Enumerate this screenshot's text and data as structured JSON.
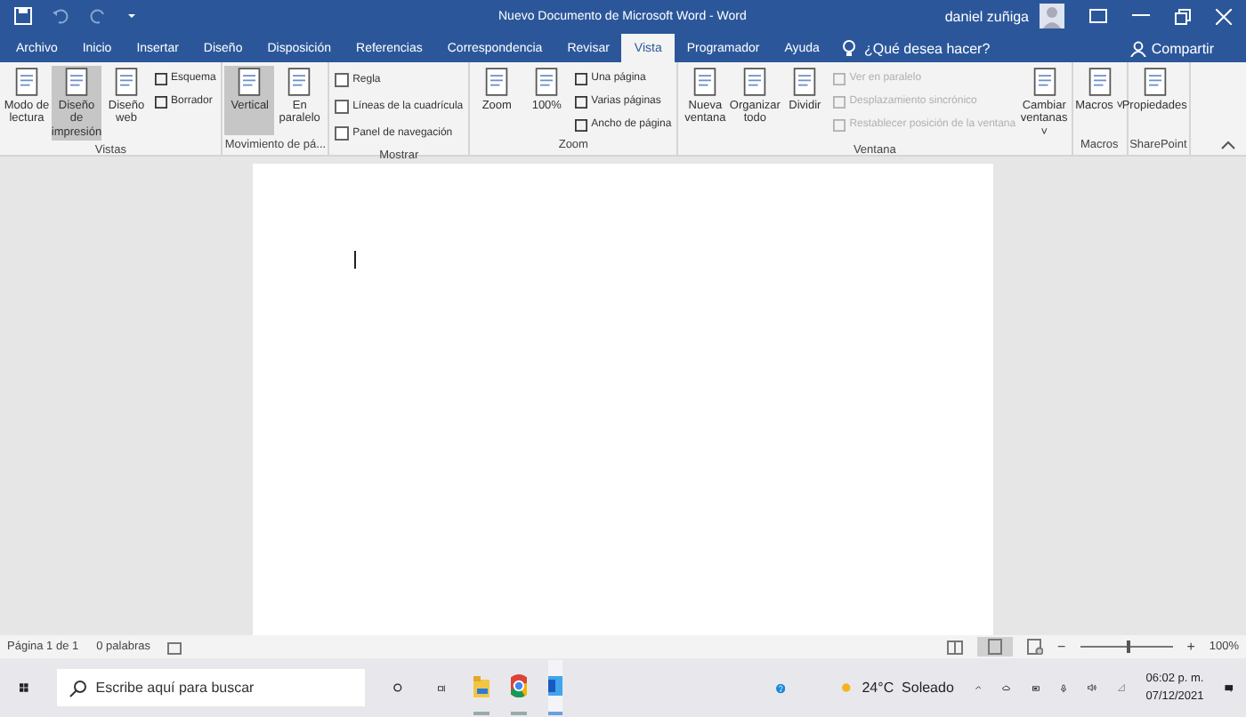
{
  "title": "Nuevo Documento de Microsoft Word  -  Word",
  "user": "daniel zuñiga",
  "tabs": [
    {
      "label": "Archivo",
      "selected": false
    },
    {
      "label": "Inicio",
      "selected": false
    },
    {
      "label": "Insertar",
      "selected": false
    },
    {
      "label": "Diseño",
      "selected": false
    },
    {
      "label": "Disposición",
      "selected": false
    },
    {
      "label": "Referencias",
      "selected": false
    },
    {
      "label": "Correspondencia",
      "selected": false
    },
    {
      "label": "Revisar",
      "selected": false
    },
    {
      "label": "Vista",
      "selected": true
    },
    {
      "label": "Programador",
      "selected": false
    },
    {
      "label": "Ayuda",
      "selected": false
    }
  ],
  "tell_me": {
    "placeholder": "¿Qué desea hacer?"
  },
  "share": "Compartir",
  "groups": [
    {
      "label": "Vistas",
      "items": [
        {
          "kind": "large",
          "label": "Modo de lectura",
          "selected": false
        },
        {
          "kind": "large",
          "label": "Diseño de impresión",
          "selected": true
        },
        {
          "kind": "large",
          "label": "Diseño web",
          "selected": false
        },
        {
          "kind": "small",
          "label": "Esquema",
          "disabled": false
        },
        {
          "kind": "small",
          "label": "Borrador",
          "disabled": false
        }
      ]
    },
    {
      "label": "Movimiento de pá...",
      "items": [
        {
          "kind": "large",
          "label": "Vertical",
          "selected": true
        },
        {
          "kind": "large",
          "label": "En paralelo",
          "selected": false
        }
      ]
    },
    {
      "label": "Mostrar",
      "items": [
        {
          "kind": "check",
          "label": "Regla",
          "checked": false
        },
        {
          "kind": "check",
          "label": "Líneas de la cuadrícula",
          "checked": false
        },
        {
          "kind": "check",
          "label": "Panel de navegación",
          "checked": false
        }
      ]
    },
    {
      "label": "Zoom",
      "items": [
        {
          "kind": "large",
          "label": "Zoom",
          "selected": false
        },
        {
          "kind": "large",
          "label": "100%",
          "selected": false
        },
        {
          "kind": "small",
          "label": "Una página",
          "disabled": false
        },
        {
          "kind": "small",
          "label": "Varias páginas",
          "disabled": false
        },
        {
          "kind": "small",
          "label": "Ancho de página",
          "disabled": false
        }
      ]
    },
    {
      "label": "Ventana",
      "items": [
        {
          "kind": "large",
          "label": "Nueva ventana",
          "selected": false
        },
        {
          "kind": "large",
          "label": "Organizar todo",
          "selected": false
        },
        {
          "kind": "large",
          "label": "Dividir",
          "selected": false
        },
        {
          "kind": "small",
          "label": "Ver en paralelo",
          "disabled": true
        },
        {
          "kind": "small",
          "label": "Desplazamiento sincrónico",
          "disabled": true
        },
        {
          "kind": "small",
          "label": "Restablecer posición de la ventana",
          "disabled": true
        },
        {
          "kind": "large",
          "label": "Cambiar ventanas ˅",
          "selected": false
        }
      ]
    },
    {
      "label": "Macros",
      "items": [
        {
          "kind": "large",
          "label": "Macros ˅",
          "selected": false
        }
      ]
    },
    {
      "label": "SharePoint",
      "items": [
        {
          "kind": "large",
          "label": "Propiedades",
          "selected": false
        }
      ]
    }
  ],
  "status": {
    "page": "Página 1 de 1",
    "words": "0 palabras",
    "zoom": "100%",
    "zoom_out": "−",
    "zoom_in": "+",
    "level": 0.5
  },
  "taskbar": {
    "search": {
      "placeholder": "Escribe aquí para buscar"
    },
    "apps": [
      {
        "kind": "explorer",
        "selected": false
      },
      {
        "kind": "chrome",
        "selected": false
      },
      {
        "kind": "word",
        "selected": true
      }
    ],
    "weather": "24°C  Soleado",
    "time": "06:02 p. m.",
    "date": "07/12/2021"
  }
}
